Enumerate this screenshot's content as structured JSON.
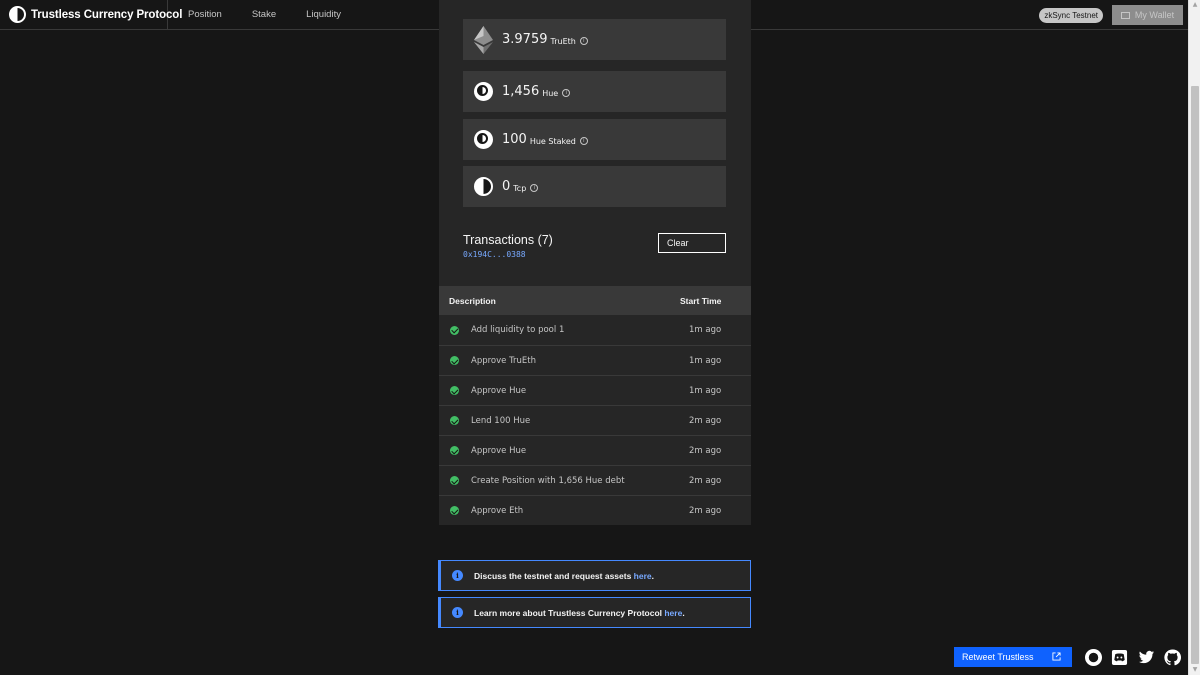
{
  "header": {
    "brand": "Trustless Currency Protocol",
    "nav": [
      "Position",
      "Stake",
      "Liquidity"
    ],
    "network": "zkSync Testnet",
    "wallet_label": "My Wallet"
  },
  "balances": [
    {
      "amount": "3.9759",
      "unit": "TruEth",
      "icon": "eth-icon"
    },
    {
      "amount": "1,456",
      "unit": "Hue",
      "icon": "hue-icon"
    },
    {
      "amount": "100",
      "unit": "Hue Staked",
      "icon": "hue-icon"
    },
    {
      "amount": "0",
      "unit": "Tcp",
      "icon": "tcp-icon"
    }
  ],
  "transactions": {
    "title": "Transactions (7)",
    "address": "0x194C...0388",
    "clear_label": "Clear",
    "columns": [
      "Description",
      "Start Time"
    ],
    "rows": [
      {
        "description": "Add liquidity to pool 1",
        "start_time": "1m ago",
        "status": "success"
      },
      {
        "description": "Approve TruEth",
        "start_time": "1m ago",
        "status": "success"
      },
      {
        "description": "Approve Hue",
        "start_time": "1m ago",
        "status": "success"
      },
      {
        "description": "Lend 100 Hue",
        "start_time": "2m ago",
        "status": "success"
      },
      {
        "description": "Approve Hue",
        "start_time": "2m ago",
        "status": "success"
      },
      {
        "description": "Create Position with 1,656 Hue debt",
        "start_time": "2m ago",
        "status": "success"
      },
      {
        "description": "Approve Eth",
        "start_time": "2m ago",
        "status": "success"
      }
    ]
  },
  "notices": [
    {
      "text": "Discuss the testnet and request assets ",
      "link": "here",
      "suffix": "."
    },
    {
      "text": "Learn more about Trustless Currency Protocol ",
      "link": "here",
      "suffix": "."
    }
  ],
  "footer": {
    "retweet_label": "Retweet Trustless",
    "social_icons": [
      "logo-icon",
      "discord-icon",
      "twitter-icon",
      "github-icon"
    ]
  },
  "colors": {
    "background": "#161616",
    "panel": "#262626",
    "card": "#393939",
    "accent_blue": "#0f62fe",
    "link_blue": "#78a9ff",
    "success_green": "#42be65"
  }
}
